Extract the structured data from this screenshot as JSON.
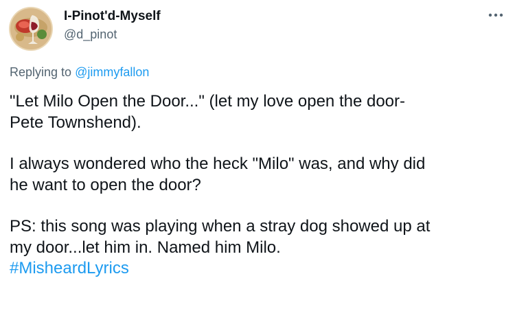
{
  "tweet": {
    "author": {
      "display_name": "I-Pinot'd-Myself",
      "handle": "@d_pinot",
      "avatar_icon": "wine-glass-avatar-icon"
    },
    "more_icon": "more-dots-icon",
    "reply_prefix": "Replying to ",
    "reply_to": "@jimmyfallon",
    "body": {
      "p1_line1": "\"Let Milo Open the Door...\" (let my love open the door-",
      "p1_line2": "Pete Townshend).",
      "p2_line1": "I always wondered who the heck \"Milo\" was, and why did",
      "p2_line2": "he want to open the door?",
      "p3_line1": "PS: this song was playing when a stray dog showed up at",
      "p3_line2": "my door...let him in. Named him Milo.",
      "hashtag": "#MisheardLyrics"
    },
    "colors": {
      "text": "#0f1419",
      "secondary": "#536471",
      "link": "#1d9bf0"
    }
  }
}
